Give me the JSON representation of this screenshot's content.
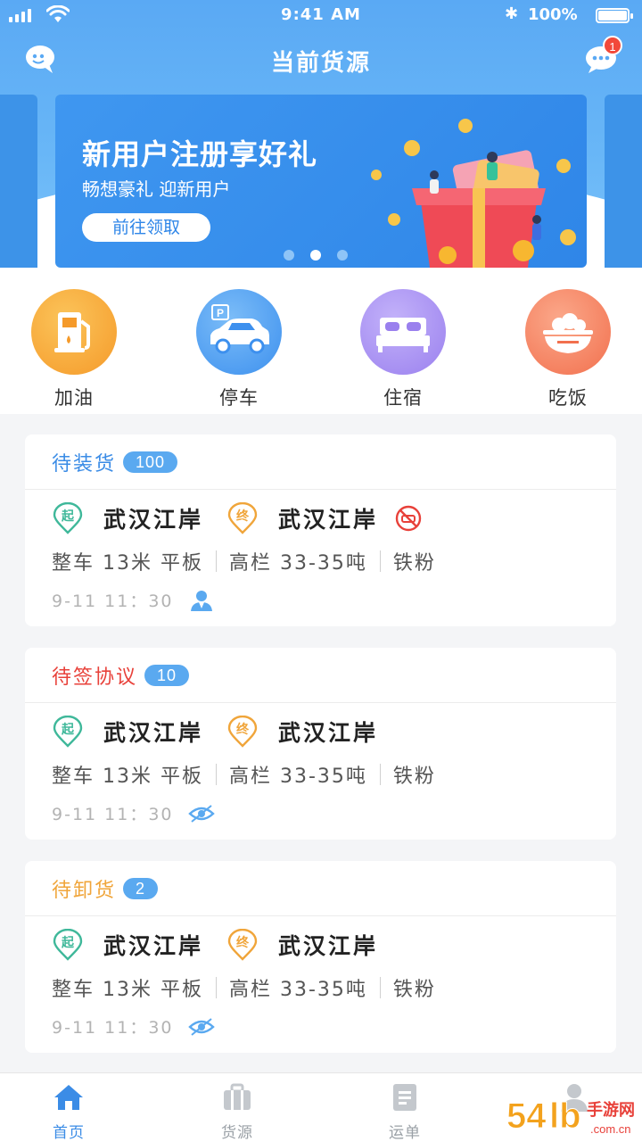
{
  "status_bar": {
    "time": "9:41 AM",
    "battery": "100%"
  },
  "header": {
    "title": "当前货源",
    "message_badge": "1"
  },
  "banner": {
    "title": "新用户注册享好礼",
    "subtitle": "畅想豪礼 迎新用户",
    "button": "前往领取",
    "page_index": 1,
    "page_count": 3
  },
  "quick_actions": [
    {
      "label": "加油",
      "icon": "gas-pump-icon",
      "color": "#f7a83a"
    },
    {
      "label": "停车",
      "icon": "parking-car-icon",
      "color": "#4a9cf1"
    },
    {
      "label": "住宿",
      "icon": "bed-icon",
      "color": "#a58cf0"
    },
    {
      "label": "吃饭",
      "icon": "food-bowl-icon",
      "color": "#f47a5a"
    }
  ],
  "orders": [
    {
      "status": "待装货",
      "status_color": "#3b8ce6",
      "count": "100",
      "start_mark": "起",
      "start": "武汉江岸",
      "end_mark": "终",
      "end": "武汉江岸",
      "specs": [
        "整车 13米 平板",
        "高栏 33-35吨",
        "铁粉"
      ],
      "time": "9-11 11：30",
      "meta_icon": "driver-icon"
    },
    {
      "status": "待签协议",
      "status_color": "#e8413a",
      "count": "10",
      "start_mark": "起",
      "start": "武汉江岸",
      "end_mark": "终",
      "end": "武汉江岸",
      "specs": [
        "整车 13米 平板",
        "高栏 33-35吨",
        "铁粉"
      ],
      "time": "9-11 11：30",
      "meta_icon": "eye-icon"
    },
    {
      "status": "待卸货",
      "status_color": "#f0a53a",
      "count": "2",
      "start_mark": "起",
      "start": "武汉江岸",
      "end_mark": "终",
      "end": "武汉江岸",
      "specs": [
        "整车 13米 平板",
        "高栏 33-35吨",
        "铁粉"
      ],
      "time": "9-11 11：30",
      "meta_icon": "eye-icon"
    }
  ],
  "tabs": [
    {
      "label": "首页",
      "icon": "home-icon",
      "active": true
    },
    {
      "label": "货源",
      "icon": "cargo-icon",
      "active": false
    },
    {
      "label": "运单",
      "icon": "waybill-icon",
      "active": false
    },
    {
      "label": "",
      "icon": "profile-icon",
      "active": false
    }
  ],
  "watermark": "54手游网"
}
